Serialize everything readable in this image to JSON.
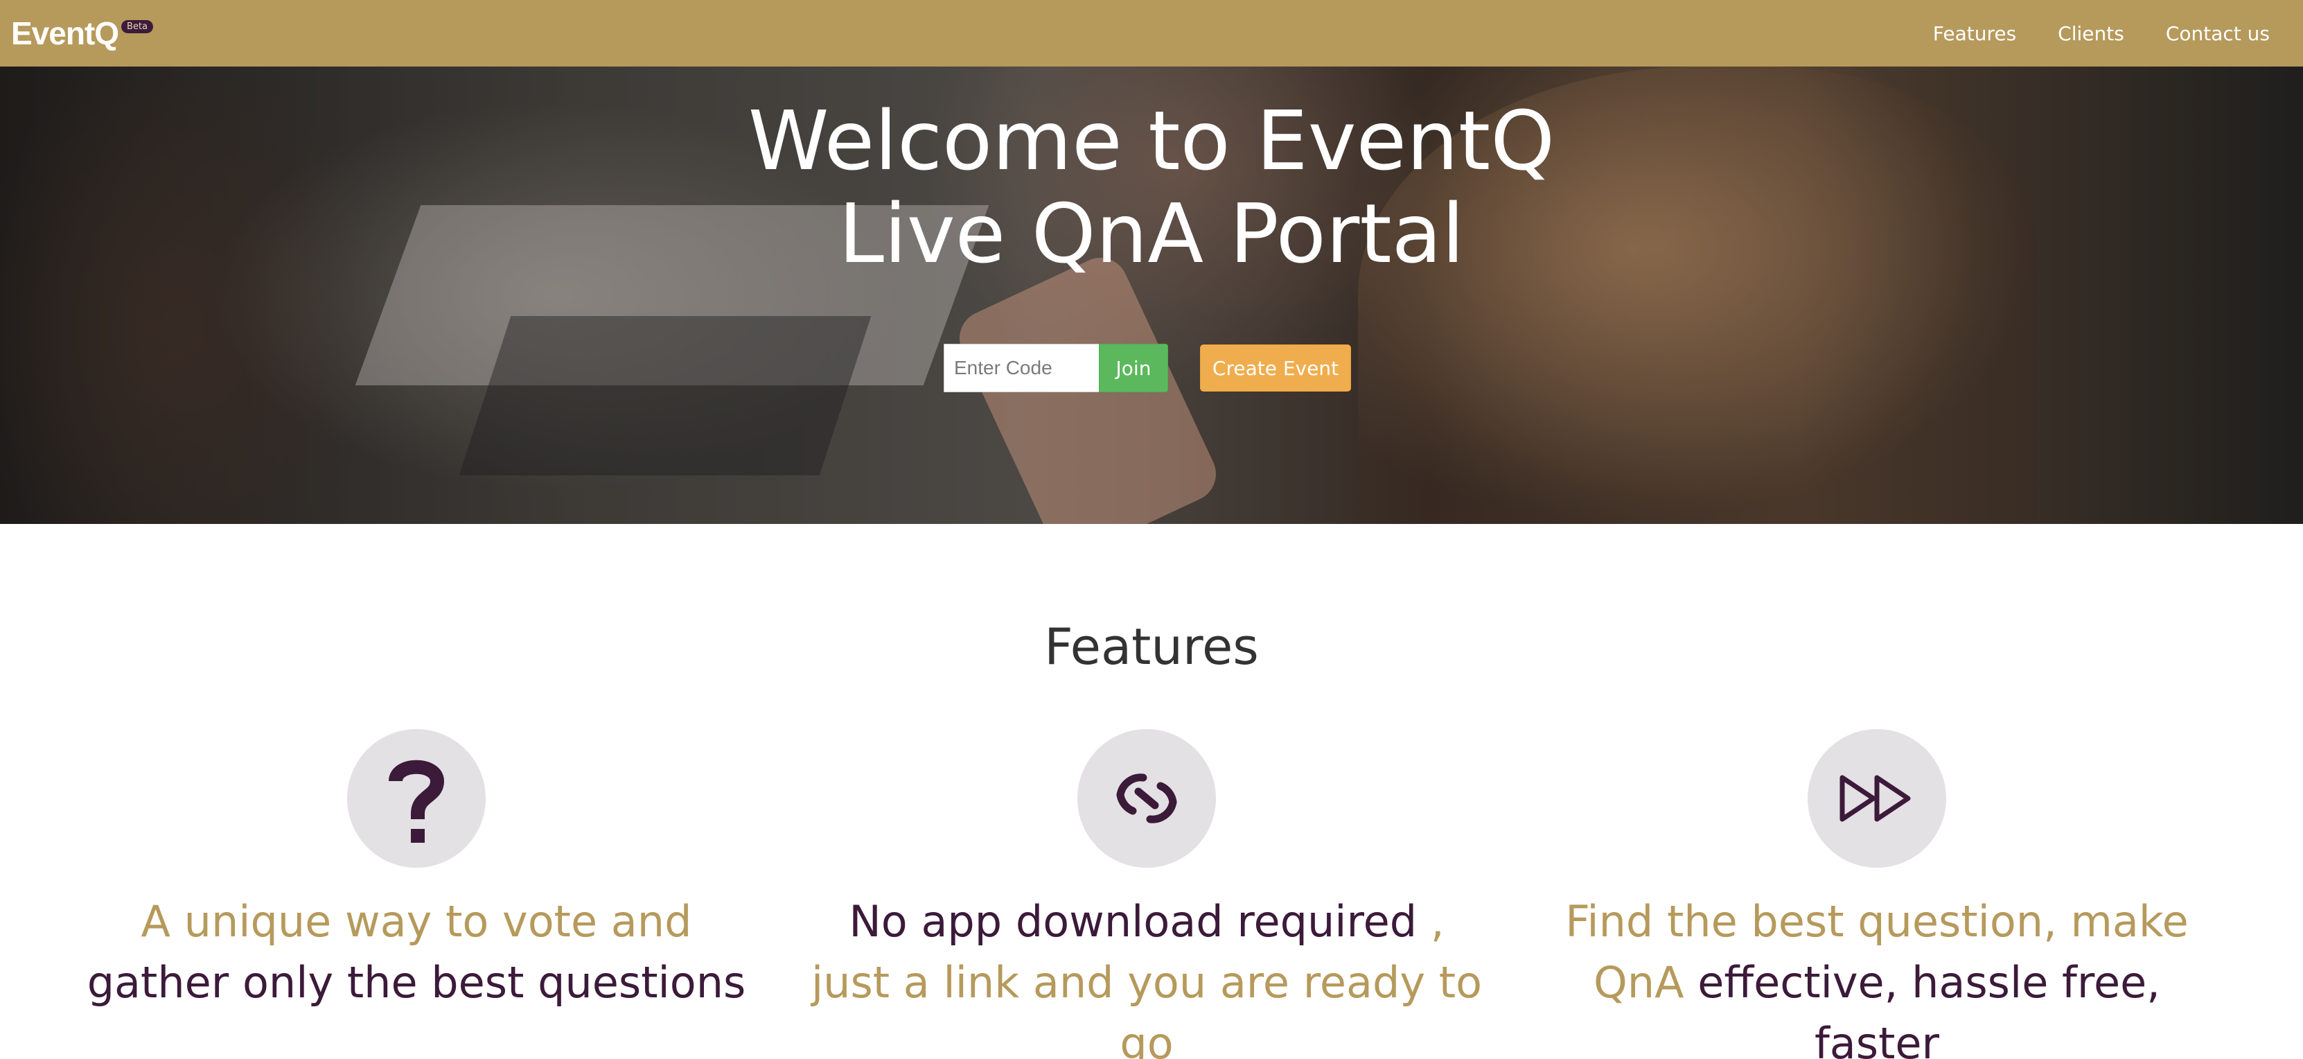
{
  "navbar": {
    "brand": "EventQ",
    "badge": "Beta",
    "links": [
      "Features",
      "Clients",
      "Contact us"
    ]
  },
  "hero": {
    "title_line1": "Welcome to EventQ",
    "title_line2": "Live QnA Portal",
    "code_placeholder": "Enter Code",
    "join_label": "Join",
    "create_label": "Create Event"
  },
  "features": {
    "heading": "Features",
    "items": [
      {
        "icon": "question-mark-icon",
        "text_gold": "A unique way to vote and",
        "text_dark": " gather only the best questions"
      },
      {
        "icon": "link-icon",
        "text_dark": "No app download required",
        "text_gold": " , just a link and you are ready to go"
      },
      {
        "icon": "fast-forward-icon",
        "text_gold": "Find the best question, make QnA",
        "text_dark": " effective, hassle free, faster"
      }
    ]
  },
  "colors": {
    "navbar": "#b69a5c",
    "accent_gold": "#b69a5c",
    "accent_dark": "#3c1a3a",
    "join_button": "#5cb85c",
    "create_button": "#efad4e"
  }
}
